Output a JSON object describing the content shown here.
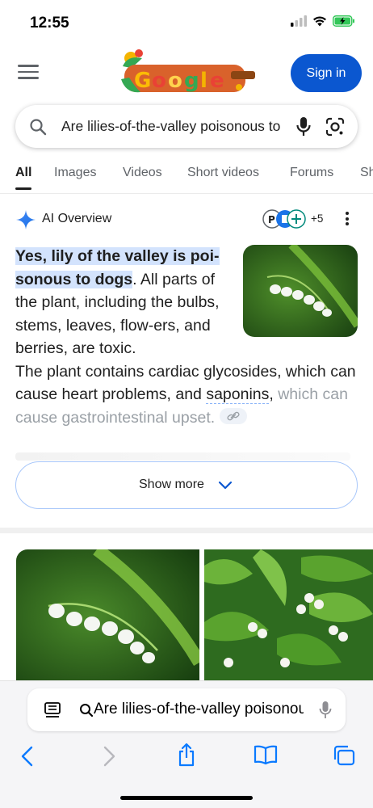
{
  "status_bar": {
    "time": "12:55",
    "battery_color": "#34c759"
  },
  "header": {
    "sign_in_label": "Sign in",
    "accent": "#0b57d0"
  },
  "search": {
    "query": "Are lilies-of-the-valley poisonous to dogs"
  },
  "tabs": [
    "All",
    "Images",
    "Videos",
    "Short videos",
    "Forums",
    "Shopping"
  ],
  "ai_overview": {
    "title": "AI Overview",
    "sources_more": "+5",
    "answer_highlight": "Yes, lily of the valley is poi-sonous to dogs",
    "answer_rest_narrow": ". All parts of the plant, including the bulbs, stems, leaves, flow-ers, and berries, are toxic.",
    "answer_line2_start": "The plant contains cardiac glycosides, which can cause heart problems, and ",
    "answer_link_word": "saponins",
    "answer_line2_end": ",",
    "answer_faded": "which can cause gastrointestinal upset.",
    "show_more_label": "Show more"
  },
  "bottom_bar": {
    "url_text": "Are lilies-of-the-valley poisonous to dogs"
  }
}
